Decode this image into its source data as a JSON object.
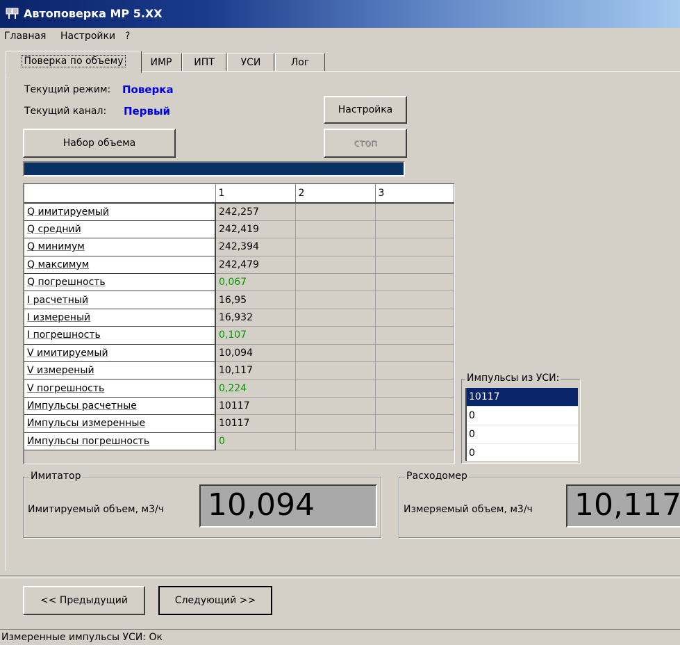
{
  "window": {
    "title": "Автоповерка MP 5.XX"
  },
  "menu": [
    "Главная",
    "Настройки",
    "?"
  ],
  "tabs": [
    "Поверка по объему",
    "ИМР",
    "ИПТ",
    "УСИ",
    "Лог"
  ],
  "mode": {
    "label": "Текущий режим:",
    "value": "Поверка"
  },
  "channel": {
    "label": "Текущий канал:",
    "value": "Первый"
  },
  "buttons": {
    "settings": "Настройка",
    "collect_volume": "Набор объема",
    "stop": "стоп",
    "prev": "<< Предыдущий",
    "next": "Следующий >>"
  },
  "progress": {
    "percent": 100
  },
  "grid": {
    "columns": [
      "",
      "1",
      "2",
      "3"
    ],
    "rows": [
      {
        "label": "Q имитируемый",
        "values": [
          "242,257",
          "",
          ""
        ]
      },
      {
        "label": "Q средний",
        "values": [
          "242,419",
          "",
          ""
        ]
      },
      {
        "label": "Q минимум",
        "values": [
          "242,394",
          "",
          ""
        ]
      },
      {
        "label": "Q максимум",
        "values": [
          "242,479",
          "",
          ""
        ]
      },
      {
        "label": "Q погрешность",
        "values": [
          "0,067",
          "",
          ""
        ]
      },
      {
        "label": "I расчетный",
        "values": [
          "16,95",
          "",
          ""
        ]
      },
      {
        "label": "I измереный",
        "values": [
          "16,932",
          "",
          ""
        ]
      },
      {
        "label": "I погрешность",
        "values": [
          "0,107",
          "",
          ""
        ]
      },
      {
        "label": "V имитируемый",
        "values": [
          "10,094",
          "",
          ""
        ]
      },
      {
        "label": "V измереный",
        "values": [
          "10,117",
          "",
          ""
        ]
      },
      {
        "label": "V погрешность",
        "values": [
          "0,224",
          "",
          ""
        ]
      },
      {
        "label": "Импульсы расчетные",
        "values": [
          "10117",
          "",
          ""
        ]
      },
      {
        "label": "Импульсы измеренные",
        "values": [
          "10117",
          "",
          ""
        ]
      },
      {
        "label": "Импульсы погрешность",
        "values": [
          "0",
          "",
          ""
        ]
      }
    ],
    "green_rows": [
      4,
      7,
      10,
      13
    ]
  },
  "usi_pulses": {
    "label": "Импульсы из УСИ:",
    "items": [
      "10117",
      "0",
      "0",
      "0"
    ],
    "selected": 0
  },
  "simulator": {
    "title": "Имитатор",
    "label": "Имитируемый объем, м3/ч",
    "value": "10,094"
  },
  "flowmeter": {
    "title": "Расходомер",
    "label": "Измеряемый объем, м3/ч",
    "value": "10,117"
  },
  "status": "Измеренные импульсы УСИ: Ок",
  "colors": {
    "selection": "#0a246a",
    "good_value": "#009a00",
    "mode_text": "#0000e0",
    "progress": "#0a3163"
  }
}
